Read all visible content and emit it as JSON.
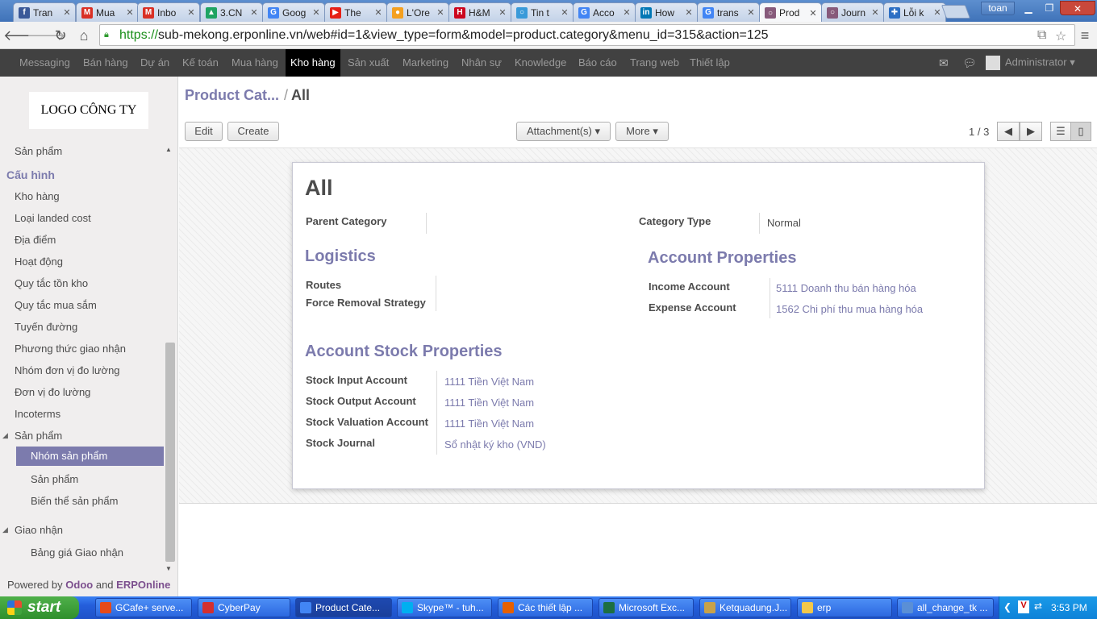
{
  "browser": {
    "tabs": [
      {
        "label": "Tran",
        "icon": "facebook-icon",
        "color": "#3b5998",
        "glyph": "f"
      },
      {
        "label": "Mua",
        "icon": "gmail-icon",
        "color": "#d93025",
        "glyph": "M"
      },
      {
        "label": "Inbo",
        "icon": "gmail-icon",
        "color": "#d93025",
        "glyph": "M"
      },
      {
        "label": "3.CN",
        "icon": "google-drive-icon",
        "color": "#1fa463",
        "glyph": "▲"
      },
      {
        "label": "Goog",
        "icon": "google-icon",
        "color": "#4285f4",
        "glyph": "G"
      },
      {
        "label": "The",
        "icon": "youtube-icon",
        "color": "#e62117",
        "glyph": "▶"
      },
      {
        "label": "L'Ore",
        "icon": "loreal-icon",
        "color": "#f4a020",
        "glyph": "●"
      },
      {
        "label": "H&M",
        "icon": "hm-icon",
        "color": "#cc071e",
        "glyph": "H"
      },
      {
        "label": "Tin t",
        "icon": "loading-icon",
        "color": "#3a9ad9",
        "glyph": "○"
      },
      {
        "label": "Acco",
        "icon": "google-icon",
        "color": "#4285f4",
        "glyph": "G"
      },
      {
        "label": "How",
        "icon": "linkedin-icon",
        "color": "#0077b5",
        "glyph": "in"
      },
      {
        "label": "trans",
        "icon": "google-icon",
        "color": "#4285f4",
        "glyph": "G"
      },
      {
        "label": "Prod",
        "icon": "odoo-icon",
        "color": "#875a7b",
        "glyph": "○",
        "active": true
      },
      {
        "label": "Journ",
        "icon": "odoo-icon",
        "color": "#875a7b",
        "glyph": "○"
      },
      {
        "label": "Lỗi k",
        "icon": "puzzle-icon",
        "color": "#2d6fc4",
        "glyph": "✚"
      }
    ],
    "user": "toan",
    "url_scheme": "https://",
    "url_rest": "sub-mekong.erponline.vn/web#id=1&view_type=form&model=product.category&menu_id=315&action=125"
  },
  "topmenu": {
    "items": [
      "Messaging",
      "Bán hàng",
      "Dự án",
      "Kế toán",
      "Mua hàng",
      "Kho hàng",
      "Sản xuất",
      "Marketing",
      "Nhân sự",
      "Knowledge",
      "Báo cáo",
      "Trang web",
      "Thiết lập"
    ],
    "active": "Kho hàng",
    "user": "Administrator"
  },
  "sidebar": {
    "logo": "LOGO CÔNG TY",
    "top_item": "Sản phẩm",
    "config_header": "Cấu hình",
    "config_items": [
      "Kho hàng",
      "Loại landed cost",
      "Địa điểm",
      "Hoạt động",
      "Quy tắc tồn kho",
      "Quy tắc mua sắm",
      "Tuyến đường",
      "Phương thức giao nhận",
      "Nhóm đơn vị đo lường",
      "Đơn vị đo lường",
      "Incoterms"
    ],
    "product_group": "Sản phẩm",
    "product_items": [
      "Nhóm sản phẩm",
      "Sản phẩm",
      "Biến thể sản phẩm"
    ],
    "selected": "Nhóm sản phẩm",
    "delivery_group": "Giao nhận",
    "delivery_items": [
      "Bảng giá Giao nhận"
    ],
    "powered_prefix": "Powered by",
    "powered_odoo": "Odoo",
    "powered_and": "and",
    "powered_erp": "ERPOnline"
  },
  "main": {
    "breadcrumb_parent": "Product Cat...",
    "breadcrumb_sep": "/",
    "breadcrumb_current": "All",
    "edit_label": "Edit",
    "create_label": "Create",
    "attachments_label": "Attachment(s) ▾",
    "more_label": "More ▾",
    "pager": "1 / 3"
  },
  "form": {
    "title": "All",
    "parent_category_label": "Parent Category",
    "parent_category_value": "",
    "category_type_label": "Category Type",
    "category_type_value": "Normal",
    "logistics_title": "Logistics",
    "routes_label": "Routes",
    "removal_label": "Force Removal Strategy",
    "account_props_title": "Account Properties",
    "income_label": "Income Account",
    "income_value": "5111 Doanh thu bán hàng hóa",
    "expense_label": "Expense Account",
    "expense_value": "1562 Chi phí thu mua hàng hóa",
    "stock_props_title": "Account Stock Properties",
    "stock_input_label": "Stock Input Account",
    "stock_input_value": "1111 Tiền Việt Nam",
    "stock_output_label": "Stock Output Account",
    "stock_output_value": "1111 Tiền Việt Nam",
    "stock_valuation_label": "Stock Valuation Account",
    "stock_valuation_value": "1111 Tiền Việt Nam",
    "stock_journal_label": "Stock Journal",
    "stock_journal_value": "Sổ nhật ký kho (VND)"
  },
  "taskbar": {
    "start": "start",
    "tasks": [
      {
        "label": "GCafe+ serve...",
        "color": "#e64a19"
      },
      {
        "label": "CyberPay",
        "color": "#d32f2f"
      },
      {
        "label": "Product Cate...",
        "color": "#4285f4",
        "active": true
      },
      {
        "label": "Skype™ - tuh...",
        "color": "#00aff0"
      },
      {
        "label": "Các thiết lập ...",
        "color": "#e66000"
      },
      {
        "label": "Microsoft Exc...",
        "color": "#1d6f42"
      },
      {
        "label": "Ketquadung.J...",
        "color": "#c8a24a"
      },
      {
        "label": "erp",
        "color": "#f3c84a"
      },
      {
        "label": "all_change_tk ...",
        "color": "#5a8fd6"
      }
    ],
    "clock": "3:53 PM"
  }
}
